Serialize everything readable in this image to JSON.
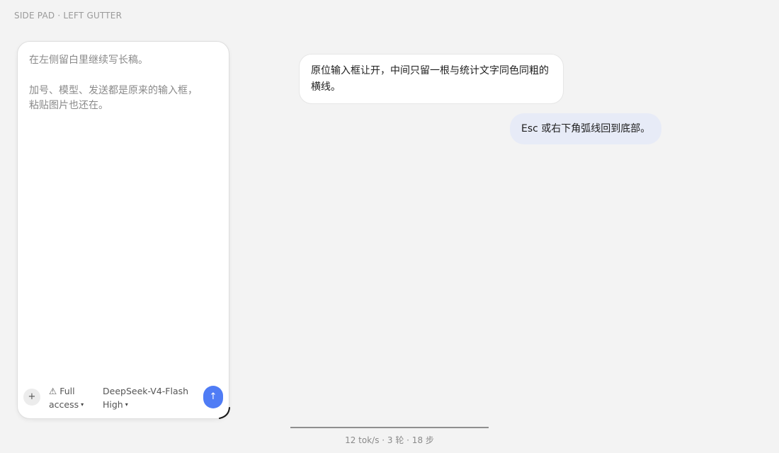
{
  "header": {
    "label": "SIDE PAD · LEFT GUTTER"
  },
  "side_pad": {
    "draft_line_1": "在左侧留白里继续写长稿。",
    "draft_line_2": "加号、模型、发送都是原来的输入框，",
    "draft_line_3": "粘贴图片也还在。",
    "plus_icon": "+",
    "warning_icon": "⚠",
    "access_line_1": "Full",
    "access_line_2": "access",
    "model_name": "DeepSeek-V4-Flash",
    "effort": "High",
    "caret_icon": "▾",
    "send_icon": "↑",
    "accent_color": "#4f7cf5"
  },
  "messages": [
    {
      "role": "assistant",
      "text": "原位输入框让开，中间只留一根与统计文字同色同粗的横线。"
    },
    {
      "role": "user",
      "text": "Esc 或右下角弧线回到底部。"
    }
  ],
  "stats": {
    "text": "12 tok/s · 3 轮 · 18 步"
  }
}
